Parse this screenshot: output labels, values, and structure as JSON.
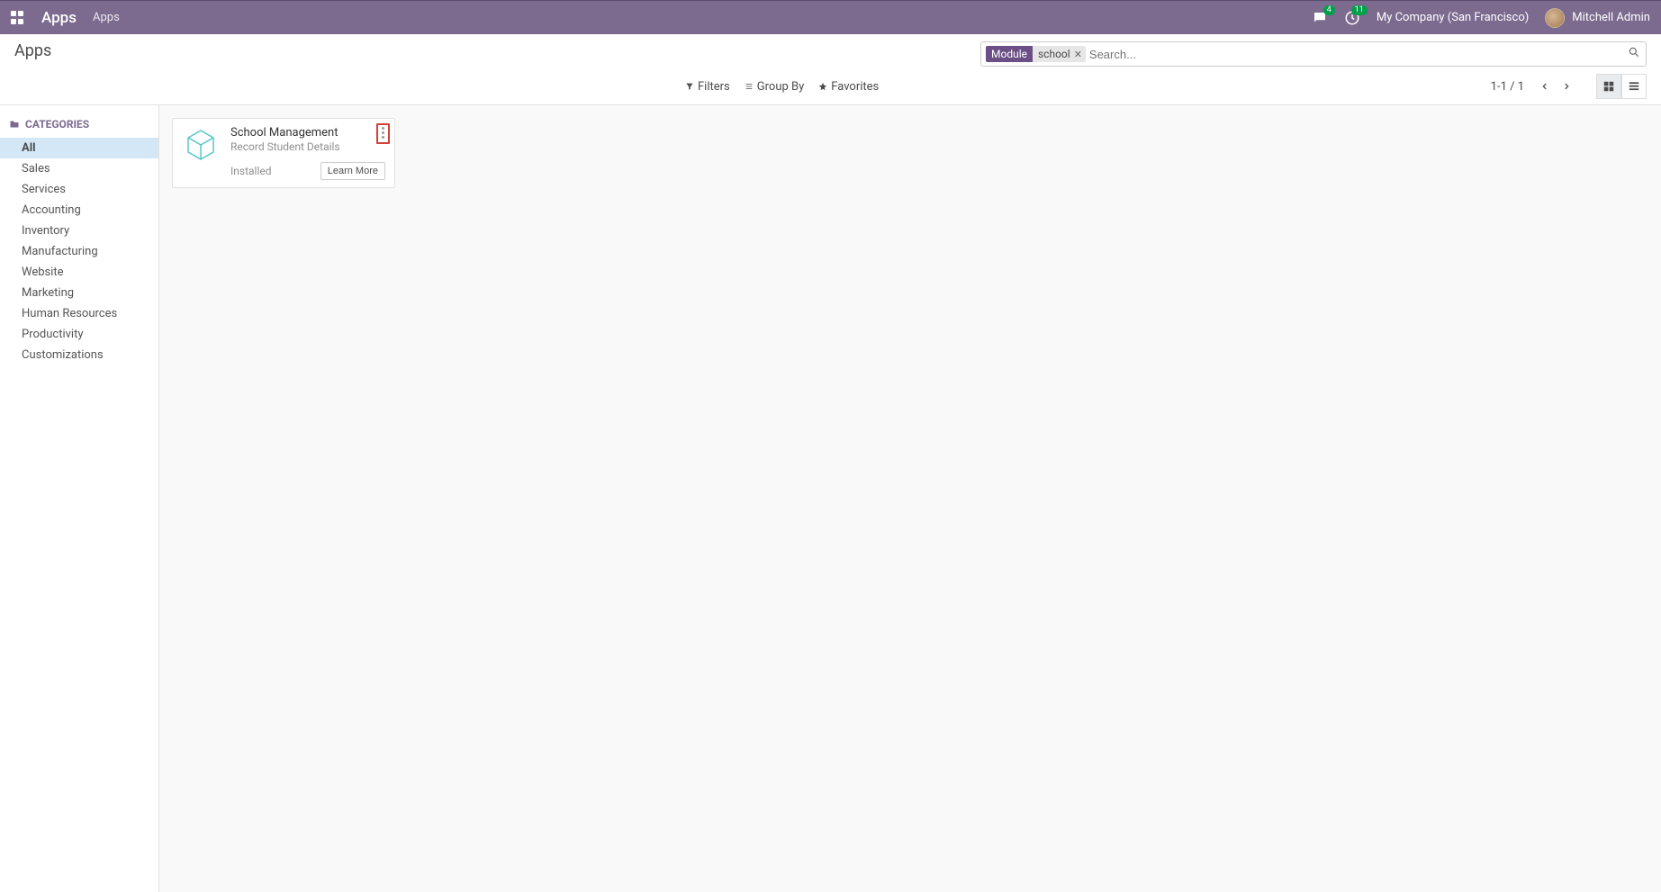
{
  "navbar": {
    "brand": "Apps",
    "nav_link": "Apps",
    "messages_badge": "4",
    "activities_badge": "11",
    "company": "My Company (San Francisco)",
    "user": "Mitchell Admin"
  },
  "header": {
    "title": "Apps",
    "search_tag_type": "Module",
    "search_tag_value": "school",
    "search_placeholder": "Search...",
    "filters_label": "Filters",
    "groupby_label": "Group By",
    "favorites_label": "Favorites",
    "pager": "1-1 / 1"
  },
  "sidebar": {
    "header": "CATEGORIES",
    "items": [
      {
        "label": "All",
        "active": true
      },
      {
        "label": "Sales"
      },
      {
        "label": "Services"
      },
      {
        "label": "Accounting"
      },
      {
        "label": "Inventory"
      },
      {
        "label": "Manufacturing"
      },
      {
        "label": "Website"
      },
      {
        "label": "Marketing"
      },
      {
        "label": "Human Resources"
      },
      {
        "label": "Productivity"
      },
      {
        "label": "Customizations"
      }
    ]
  },
  "card": {
    "title": "School Management",
    "subtitle": "Record Student Details",
    "status": "Installed",
    "button": "Learn More"
  }
}
